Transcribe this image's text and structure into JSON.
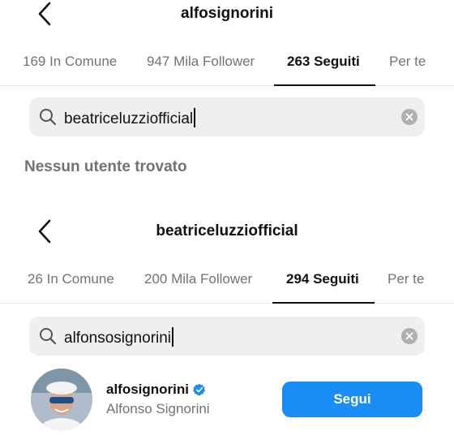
{
  "panel_a": {
    "header": {
      "title": "alfosignorini"
    },
    "tabs": [
      {
        "label": "169 In Comune",
        "active": false
      },
      {
        "label": "947 Mila Follower",
        "active": false
      },
      {
        "label": "263 Seguiti",
        "active": true
      },
      {
        "label": "Per te",
        "active": false
      }
    ],
    "search": {
      "query": "beatriceluzziofficial"
    },
    "empty_message": "Nessun utente trovato"
  },
  "panel_b": {
    "header": {
      "title": "beatriceluzziofficial"
    },
    "tabs": [
      {
        "label": "26 In Comune",
        "active": false
      },
      {
        "label": "200 Mila Follower",
        "active": false
      },
      {
        "label": "294 Seguiti",
        "active": true
      },
      {
        "label": "Per te",
        "active": false
      }
    ],
    "search": {
      "query": "alfonsosignorini"
    },
    "result": {
      "username": "alfosignorini",
      "full_name": "Alfonso Signorini",
      "verified": true,
      "follow_label": "Segui"
    }
  },
  "colors": {
    "accent": "#1a8cf5",
    "muted_text": "#737373",
    "search_bg": "#efefef",
    "verified_badge": "#1a8cf5"
  },
  "icons": [
    "back-chevron-icon",
    "search-icon",
    "clear-icon",
    "verified-badge-icon"
  ]
}
